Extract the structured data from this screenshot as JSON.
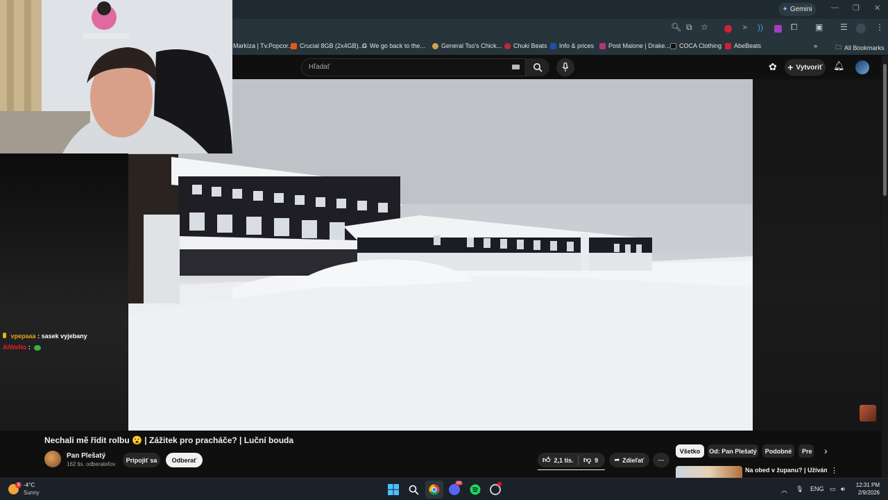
{
  "browser": {
    "gemini_label": "Gemini",
    "bookmarks": [
      {
        "label": "Markíza | Tv.Popcor...",
        "color": "#2f7dd1"
      },
      {
        "label": "Crucial 8GB (2x4GB)...",
        "color": "#e05a1c"
      },
      {
        "label": "We go back to the...",
        "color": "#9aa0a6"
      },
      {
        "label": "General Tso's Chick...",
        "color": "#d6a050"
      },
      {
        "label": "Chuki Beats",
        "color": "#c0283a"
      },
      {
        "label": "Info & prices",
        "color": "#1e4fa8"
      },
      {
        "label": "Post Malone | Drake...",
        "color": "#b0367a"
      },
      {
        "label": "COCA Clothing",
        "color": "#222222"
      },
      {
        "label": "AbeBeats",
        "color": "#d02030"
      }
    ],
    "all_bookmarks_label": "All Bookmarks",
    "overflow_label": "»"
  },
  "youtube": {
    "search_placeholder": "Hľadať",
    "create_label": "Vytvoriť",
    "video": {
      "title": "Nechali mě řídit rolbu 😮 | Zážitek pro pracháče? | Luční bouda",
      "channel": "Pan Plešatý",
      "subscribers": "162 tis. odberateľov",
      "join_label": "Pripojiť sa",
      "unsubscribe_label": "Odberať",
      "likes": "2,1 tis.",
      "dislikes": "9",
      "share_label": "Zdieľať",
      "more_label": "···"
    },
    "chips": [
      "Všetko",
      "Od: Pan Plešatý",
      "Podobné",
      "Pre"
    ],
    "chip_next": "›",
    "recommendation": {
      "title": "Na obed v županu? | Užívám si"
    }
  },
  "chat": [
    {
      "user": "vpepaaa",
      "sep": ":",
      "message": "sasek vyjebany",
      "user_color": "#e8a020"
    },
    {
      "user": "AIWeNo",
      "sep": ":",
      "message": "",
      "user_color": "#e02020"
    }
  ],
  "taskbar": {
    "weather_temp": "-4°C",
    "weather_desc": "Sunny",
    "weather_badge": "3",
    "discord_badge": "99",
    "language": "ENG",
    "time": "12:31 PM",
    "date": "2/9/2026"
  },
  "colors": {
    "accent_red": "#ff0033",
    "like_bar": "#f1f1f1"
  }
}
